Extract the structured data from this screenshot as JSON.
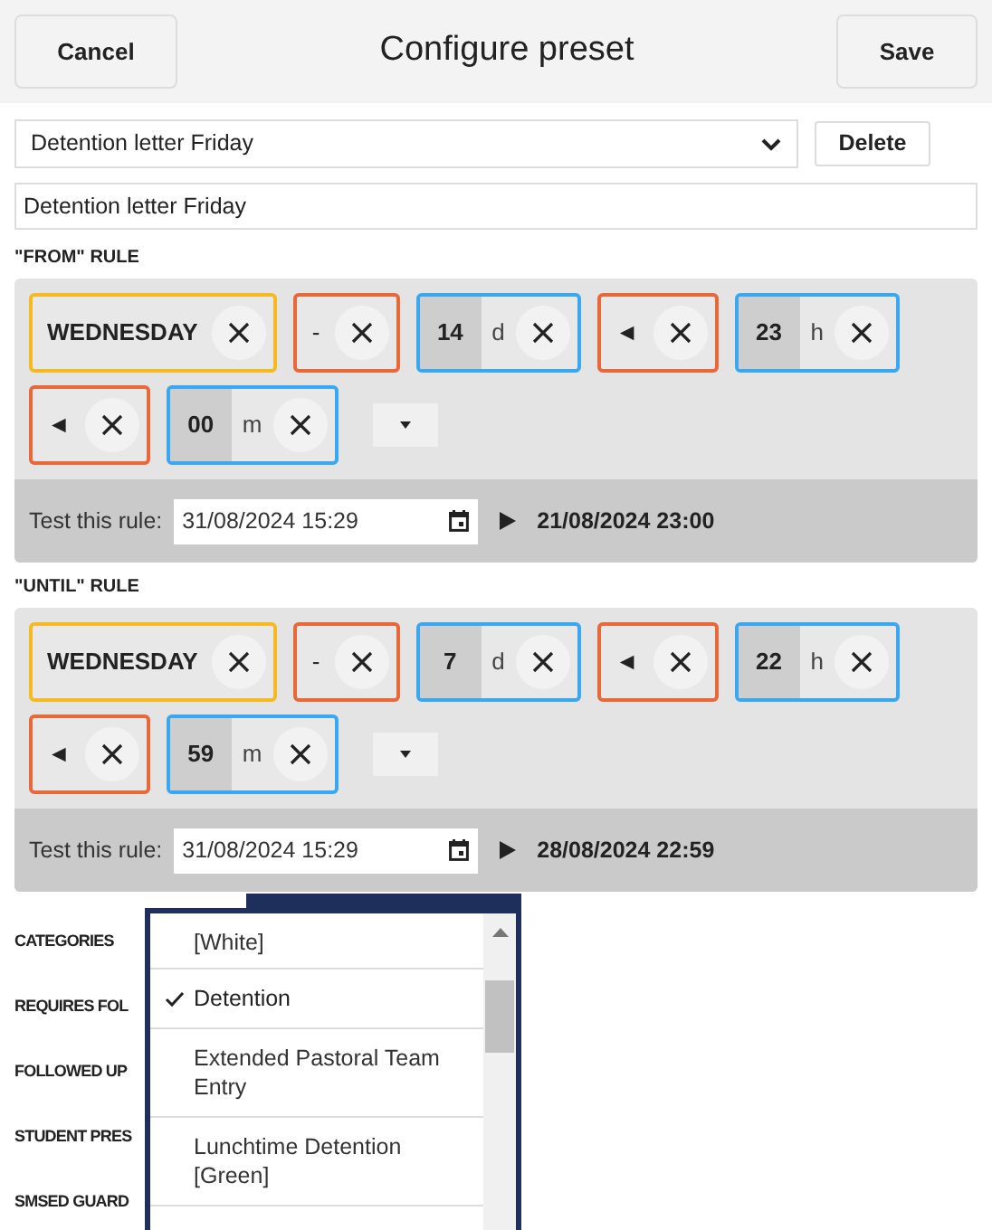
{
  "header": {
    "cancel": "Cancel",
    "title": "Configure preset",
    "save": "Save"
  },
  "preset_select": {
    "value": "Detention letter Friday"
  },
  "delete_button": "Delete",
  "name_field": {
    "value": "Detention letter Friday"
  },
  "rules": [
    {
      "label": "\"FROM\" RULE",
      "chips": [
        {
          "kind": "day",
          "value": "WEDNESDAY"
        },
        {
          "kind": "op",
          "value": "-"
        },
        {
          "kind": "num",
          "value": "14",
          "unit": "d"
        },
        {
          "kind": "op",
          "value": "◄"
        },
        {
          "kind": "num",
          "value": "23",
          "unit": "h"
        },
        {
          "kind": "op",
          "value": "◄"
        },
        {
          "kind": "num",
          "value": "00",
          "unit": "m"
        }
      ],
      "test": {
        "label": "Test this rule:",
        "value": "31/08/2024 15:29",
        "result": "21/08/2024 23:00"
      }
    },
    {
      "label": "\"UNTIL\" RULE",
      "chips": [
        {
          "kind": "day",
          "value": "WEDNESDAY"
        },
        {
          "kind": "op",
          "value": "-"
        },
        {
          "kind": "num",
          "value": "7",
          "unit": "d"
        },
        {
          "kind": "op",
          "value": "◄"
        },
        {
          "kind": "num",
          "value": "22",
          "unit": "h"
        },
        {
          "kind": "op",
          "value": "◄"
        },
        {
          "kind": "num",
          "value": "59",
          "unit": "m"
        }
      ],
      "test": {
        "label": "Test this rule:",
        "value": "31/08/2024 15:29",
        "result": "28/08/2024 22:59"
      }
    }
  ],
  "fields": [
    "CATEGORIES",
    "REQUIRES FOL",
    "FOLLOWED UP",
    "STUDENT PRES",
    "SMSED GUARD"
  ],
  "category_dropdown": {
    "items": [
      {
        "label": "[White]",
        "selected": false
      },
      {
        "label": "Detention",
        "selected": true
      },
      {
        "label": "Extended Pastoral Team Entry",
        "selected": false
      },
      {
        "label": "Lunchtime Detention [Green]",
        "selected": false
      }
    ]
  }
}
